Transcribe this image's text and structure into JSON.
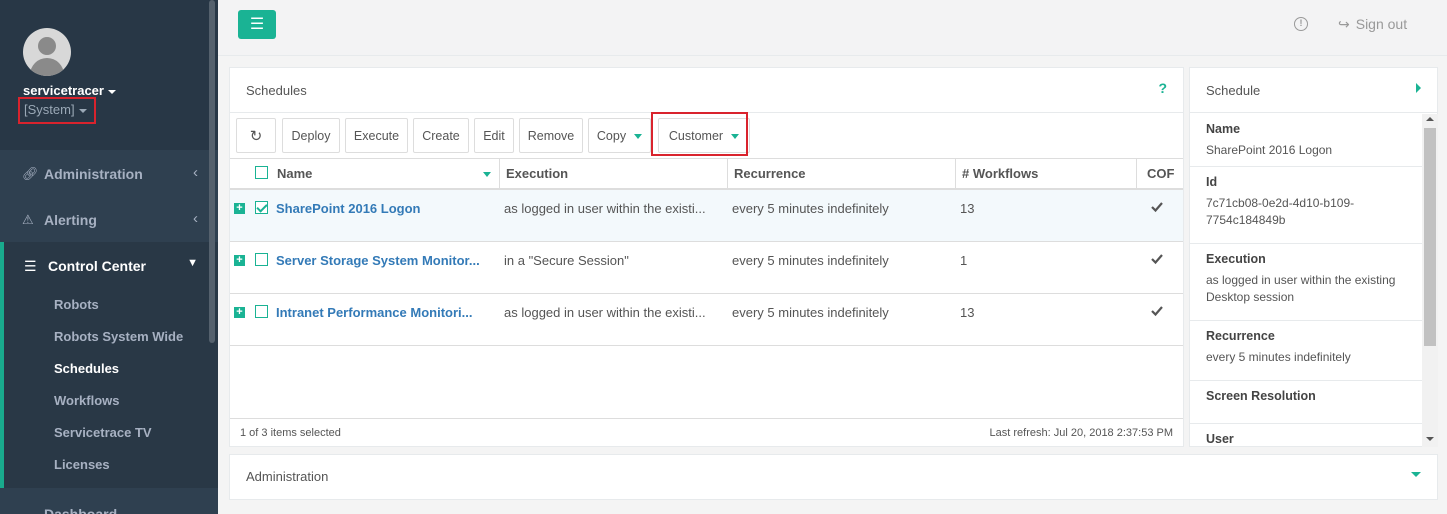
{
  "sidebar": {
    "username": "servicetracer",
    "role": "[System]",
    "nav": [
      {
        "label": "Administration",
        "icon": "link-icon"
      },
      {
        "label": "Alerting",
        "icon": "warning-icon"
      },
      {
        "label": "Control Center",
        "icon": "sitemap-icon"
      }
    ],
    "sub_items": [
      "Robots",
      "Robots System Wide",
      "Schedules",
      "Workflows",
      "Servicetrace TV",
      "Licenses"
    ],
    "active_sub": "Schedules",
    "dashboard": "Dashboard"
  },
  "topbar": {
    "sign_out": "Sign out"
  },
  "schedules": {
    "title": "Schedules",
    "help": "?",
    "toolbar": [
      "Deploy",
      "Execute",
      "Create",
      "Edit",
      "Remove",
      "Copy",
      "Customer"
    ],
    "columns": [
      "Name",
      "Execution",
      "Recurrence",
      "# Workflows",
      "COF"
    ],
    "rows": [
      {
        "name": "SharePoint 2016 Logon",
        "execution": "as logged in user within the existi...",
        "recurrence": "every 5 minutes indefinitely",
        "workflows": "13",
        "selected": true
      },
      {
        "name": "Server Storage System Monitor...",
        "execution": "in a \"Secure Session\"",
        "recurrence": "every 5 minutes indefinitely",
        "workflows": "1",
        "selected": false
      },
      {
        "name": "Intranet Performance Monitori...",
        "execution": "as logged in user within the existi...",
        "recurrence": "every 5 minutes indefinitely",
        "workflows": "13",
        "selected": false
      }
    ],
    "footer_left": "1 of 3 items selected",
    "footer_right": "Last refresh: Jul 20, 2018 2:37:53 PM"
  },
  "detail": {
    "title": "Schedule",
    "fields": [
      {
        "label": "Name",
        "value": "SharePoint 2016 Logon"
      },
      {
        "label": "Id",
        "value": "7c71cb08-0e2d-4d10-b109-7754c184849b"
      },
      {
        "label": "Execution",
        "value": "as logged in user within the existing Desktop session"
      },
      {
        "label": "Recurrence",
        "value": "every 5 minutes indefinitely"
      },
      {
        "label": "Screen Resolution",
        "value": ""
      },
      {
        "label": "User",
        "value": ""
      }
    ]
  },
  "admin_panel": {
    "title": "Administration"
  },
  "colors": {
    "accent": "#1ab394",
    "sidebar": "#2f4050",
    "highlight": "#d9232d",
    "link": "#337ab7"
  }
}
